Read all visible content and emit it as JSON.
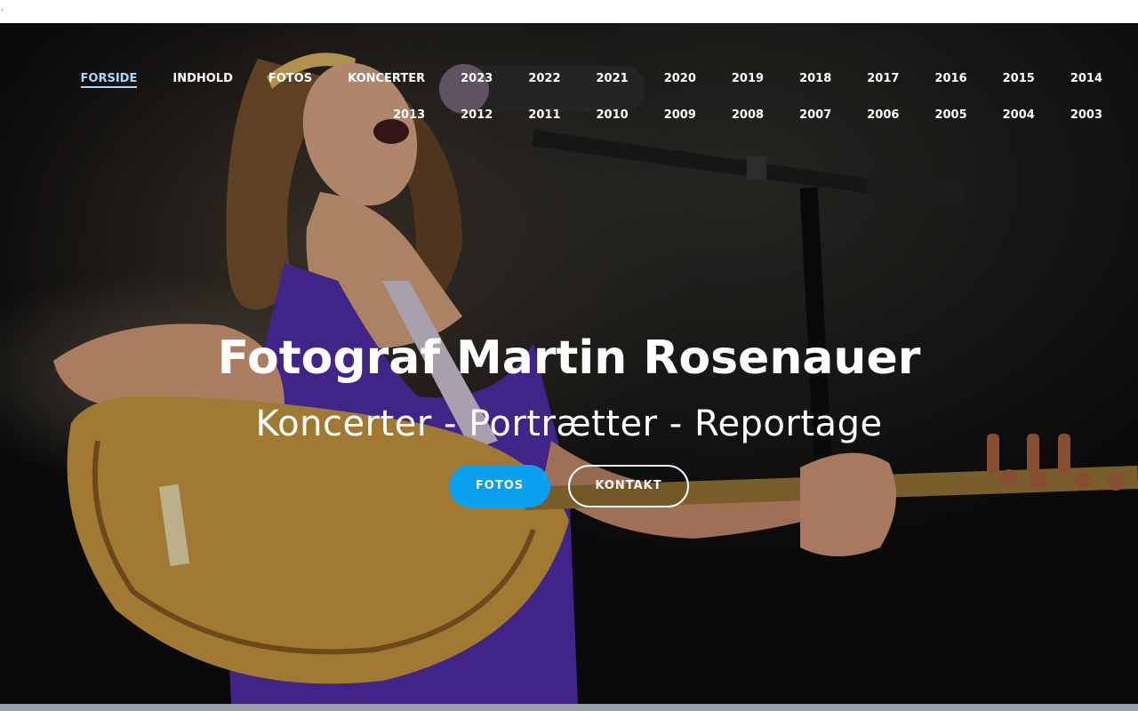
{
  "topbar": {
    "marker": "."
  },
  "nav": {
    "items": [
      "FORSIDE",
      "INDHOLD",
      "FOTOS",
      "KONCERTER",
      "2023",
      "2022",
      "2021",
      "2020",
      "2019",
      "2018",
      "2017",
      "2016",
      "2015",
      "2014",
      "2013",
      "2012",
      "2011",
      "2010",
      "2009",
      "2008",
      "2007",
      "2006",
      "2005",
      "2004",
      "2003"
    ],
    "active": "FORSIDE",
    "active_color": "#a8d8ff"
  },
  "hero": {
    "title": "Fotograf Martin Rosenauer",
    "subtitle": "Koncerter - Portrætter - Reportage",
    "buttons": {
      "fotos": "FOTOS",
      "kontakt": "KONTAKT"
    },
    "fotos_button_color": "#0aa0f0"
  }
}
